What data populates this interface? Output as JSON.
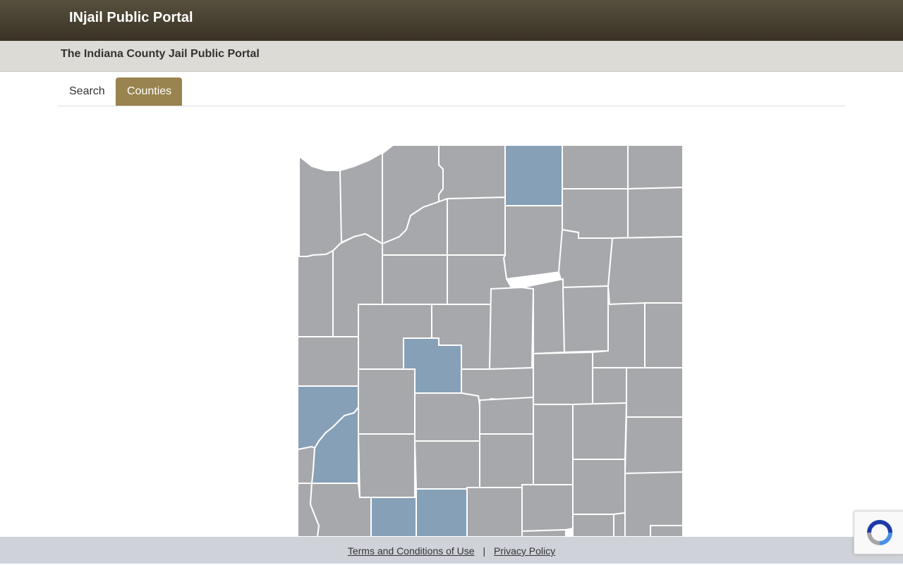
{
  "header": {
    "brand": "INjail Public Portal"
  },
  "subheader": {
    "title": "The Indiana County Jail Public Portal"
  },
  "tabs": [
    {
      "label": "Search",
      "active": false
    },
    {
      "label": "Counties",
      "active": true
    }
  ],
  "map": {
    "colors": {
      "county_default": "#a6a8ab",
      "county_highlight": "#86a0b8",
      "border": "#ffffff"
    }
  },
  "footer": {
    "terms_label": "Terms and Conditions of Use",
    "separator": "|",
    "privacy_label": "Privacy Policy"
  },
  "recaptcha": {
    "icon": "recaptcha-icon"
  },
  "theme": {
    "accent": "#99834e",
    "topbar": "#4a4333",
    "footer_bg": "#cfd2d8"
  }
}
